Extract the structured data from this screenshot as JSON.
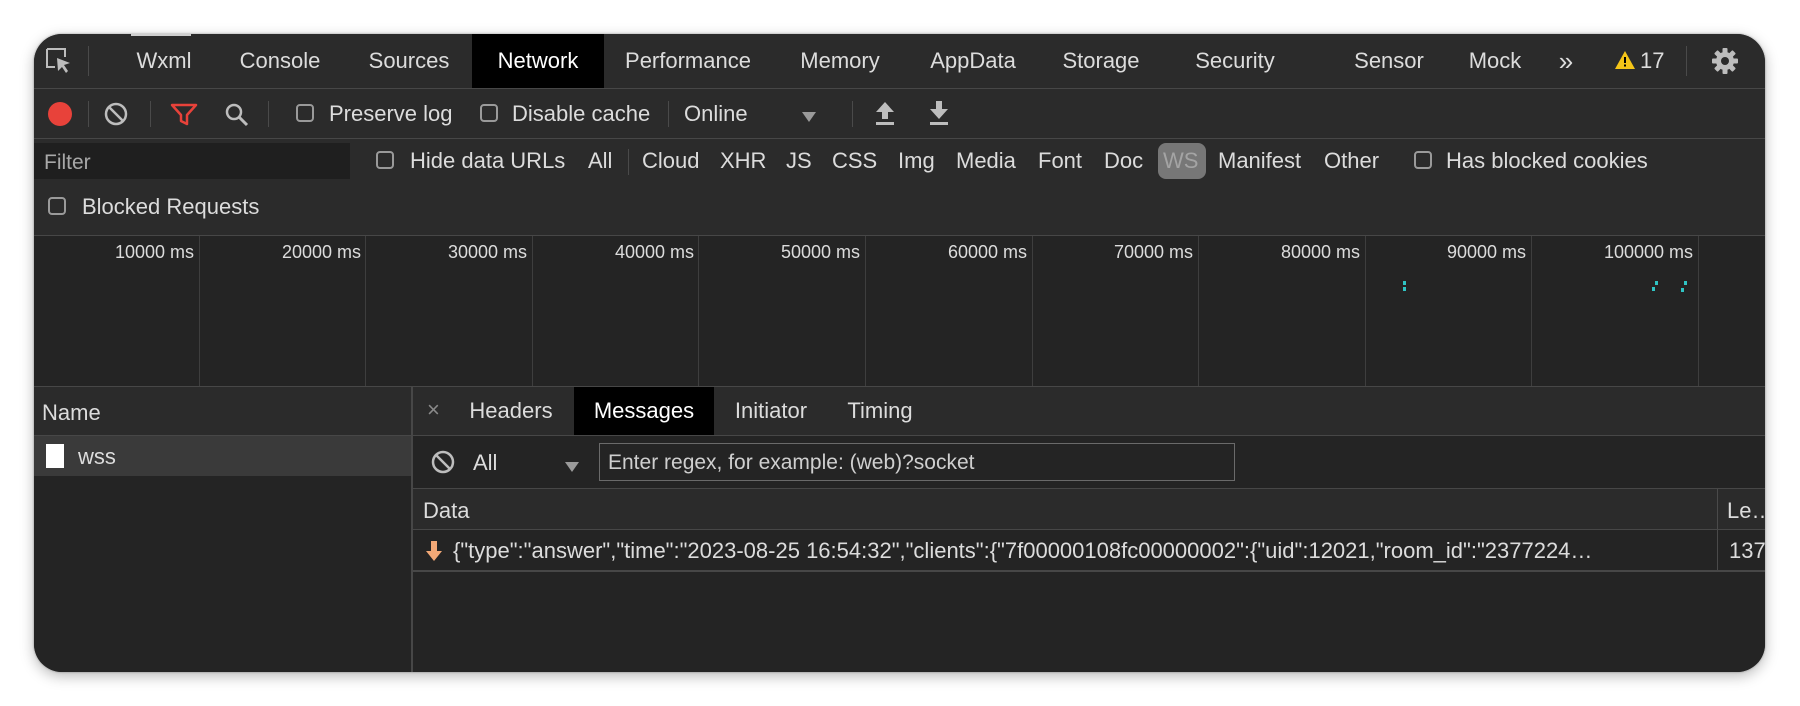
{
  "tabs": {
    "wxml": "Wxml",
    "console": "Console",
    "sources": "Sources",
    "network": "Network",
    "performance": "Performance",
    "memory": "Memory",
    "appdata": "AppData",
    "storage": "Storage",
    "security": "Security",
    "sensor": "Sensor",
    "mock": "Mock",
    "more": "»",
    "warnings_count": "17"
  },
  "toolbar": {
    "preserve_log": "Preserve log",
    "disable_cache": "Disable cache",
    "throttle": "Online"
  },
  "filter": {
    "placeholder": "Filter",
    "hide_data_urls": "Hide data URLs",
    "types": [
      "All",
      "Cloud",
      "XHR",
      "JS",
      "CSS",
      "Img",
      "Media",
      "Font",
      "Doc",
      "WS",
      "Manifest",
      "Other"
    ],
    "active_type": "WS",
    "has_blocked_cookies": "Has blocked cookies",
    "blocked_requests": "Blocked Requests"
  },
  "timeline": {
    "ticks": [
      "10000 ms",
      "20000 ms",
      "30000 ms",
      "40000 ms",
      "50000 ms",
      "60000 ms",
      "70000 ms",
      "80000 ms",
      "90000 ms",
      "100000 ms"
    ]
  },
  "request_list": {
    "header": "Name",
    "items": [
      {
        "name": "wss"
      }
    ]
  },
  "detail": {
    "tabs": [
      "Headers",
      "Messages",
      "Initiator",
      "Timing"
    ],
    "active_tab": "Messages",
    "close": "×",
    "message_filter": "All",
    "regex_placeholder": "Enter regex, for example: (web)?socket",
    "columns": {
      "data": "Data",
      "length": "Le…"
    },
    "messages": [
      {
        "direction": "received",
        "data": "{\"type\":\"answer\",\"time\":\"2023-08-25 16:54:32\",\"clients\":{\"7f00000108fc00000002\":{\"uid\":12021,\"room_id\":\"2377224…",
        "length": "137"
      }
    ]
  },
  "colors": {
    "record": "#e8423a",
    "filter_active": "#e8423a",
    "warning": "#f5c518",
    "received_arrow": "#f2a876",
    "timeline_dots": "#2fc4c4"
  }
}
